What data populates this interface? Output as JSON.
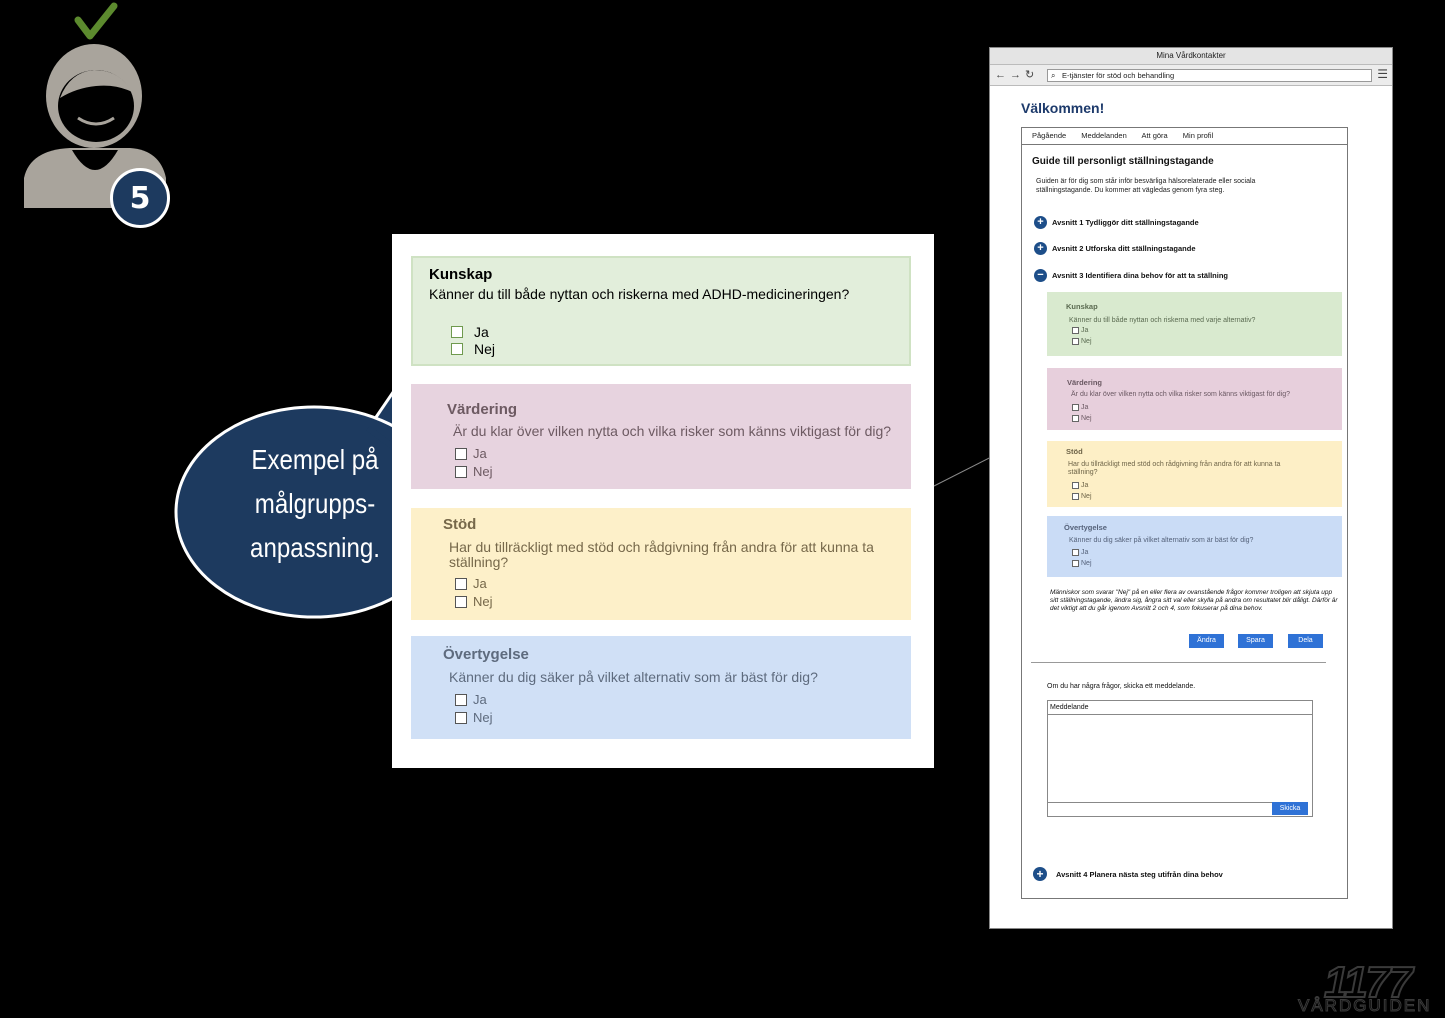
{
  "persona": {
    "step_number": "5",
    "colors": {
      "check": "#5c8a2e",
      "figure": "#a9a49c",
      "badge": "#1d3a5f"
    }
  },
  "zoom": {
    "kunskap": {
      "title": "Kunskap",
      "question": "Känner du till både nyttan och riskerna med ADHD-medicineringen?",
      "options": [
        "Ja",
        "Nej"
      ]
    },
    "vardering": {
      "title": "Värdering",
      "question": "Är du klar över vilken nytta och vilka risker som känns viktigast för dig?",
      "options": [
        "Ja",
        "Nej"
      ]
    },
    "stod": {
      "title": "Stöd",
      "question": "Har du tillräckligt med stöd och rådgivning från andra för att kunna ta ställning?",
      "options": [
        "Ja",
        "Nej"
      ]
    },
    "overtygelse": {
      "title": "Övertygelse",
      "question": "Känner du dig säker på vilket alternativ som är bäst för dig?",
      "options": [
        "Ja",
        "Nej"
      ]
    }
  },
  "bubble": {
    "lines": [
      "Exempel på",
      "målgrupps-",
      "anpassning."
    ],
    "color": "#1d3a5f"
  },
  "browser": {
    "window_title": "Mina Vårdkontakter",
    "url": "E-tjänster för stöd och behandling",
    "welcome": "Välkommen!",
    "tabs": [
      "Pågående",
      "Meddelanden",
      "Att göra",
      "Min profil"
    ],
    "guide_title": "Guide till personligt ställningstagande",
    "guide_description": "Guiden är för dig som står inför besvärliga hälsorelaterade eller sociala ställningstagande. Du kommer att vägledas genom fyra steg.",
    "sections": [
      {
        "icon": "plus",
        "label": "Avsnitt 1 Tydliggör ditt ställningstagande"
      },
      {
        "icon": "plus",
        "label": "Avsnitt 2 Utforska ditt ställningstagande"
      },
      {
        "icon": "minus",
        "label": "Avsnitt 3 Identifiera dina behov för att ta ställning"
      }
    ],
    "kunskap": {
      "title": "Kunskap",
      "question": "Känner du till både nyttan och riskerna med varje alternativ?",
      "options": [
        "Ja",
        "Nej"
      ]
    },
    "vardering": {
      "title": "Värdering",
      "question": "Är du klar över vilken nytta och vilka risker som känns viktigast för dig?",
      "options": [
        "Ja",
        "Nej"
      ]
    },
    "stod": {
      "title": "Stöd",
      "question": "Har du tillräckligt med stöd och rådgivning från andra för att kunna ta ställning?",
      "options": [
        "Ja",
        "Nej"
      ]
    },
    "overtygelse": {
      "title": "Övertygelse",
      "question": "Känner du dig säker på vilket alternativ som är bäst för dig?",
      "options": [
        "Ja",
        "Nej"
      ]
    },
    "note": "Människor som svarar \"Nej\" på en eller flera av ovanstående frågor kommer troligen att skjuta upp sitt ställningstagande, ändra sig, ångra sitt val eller skylla på andra om resultatet blir dåligt. Därför är det viktigt att du går igenom Avsnitt 2 och 4, som fokuserar på dina behov.",
    "buttons": {
      "change": "Ändra",
      "save": "Spara",
      "share": "Dela"
    },
    "ask_text": "Om du har några frågor, skicka ett meddelande.",
    "message_label": "Meddelande",
    "send_button": "Skicka",
    "section4": "Avsnitt 4 Planera nästa steg utifrån dina behov"
  },
  "logo": {
    "number": "1177",
    "name": "VÅRDGUIDEN"
  }
}
